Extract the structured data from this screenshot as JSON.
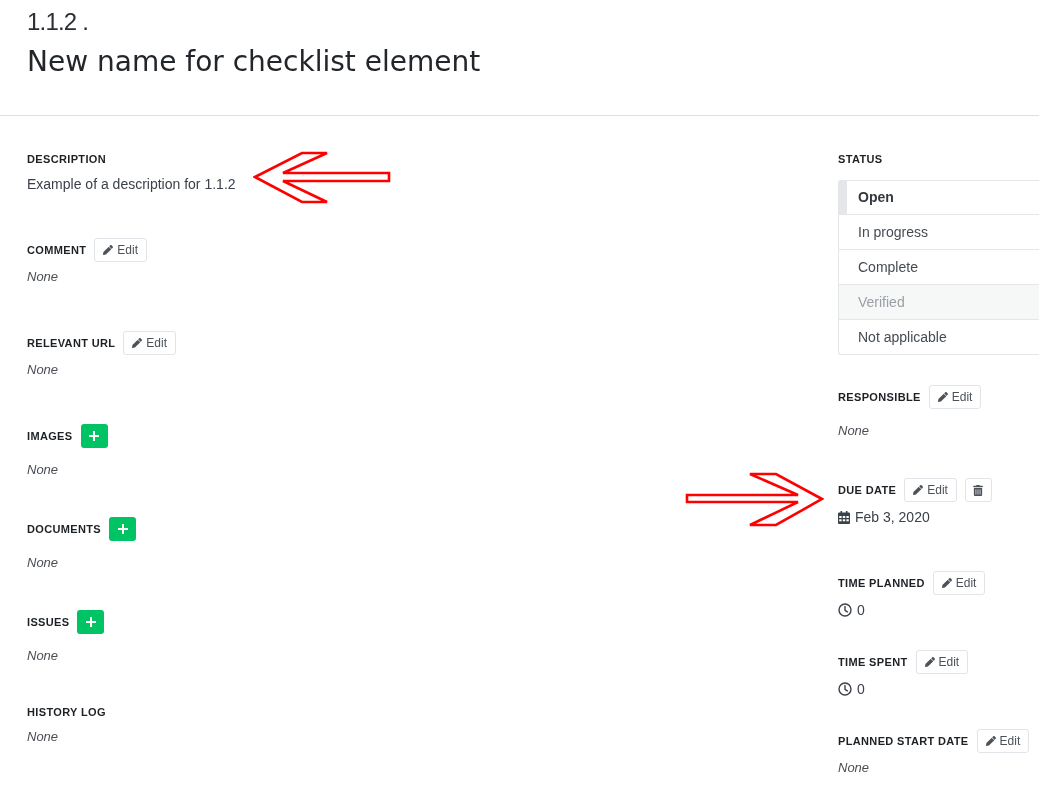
{
  "header": {
    "number": "1.1.2 .",
    "title": "New name for checklist element"
  },
  "main_sections": [
    {
      "label": "DESCRIPTION",
      "kind": "text",
      "value": "Example of a description for 1.1.2",
      "empty": false,
      "arrow": true
    },
    {
      "label": "COMMENT",
      "buttons": [
        {
          "kind": "edit",
          "label": "Edit"
        }
      ],
      "kind": "text",
      "value": "None",
      "empty": true,
      "arrow": false
    },
    {
      "label": "RELEVANT URL",
      "buttons": [
        {
          "kind": "edit",
          "label": "Edit"
        }
      ],
      "kind": "text",
      "value": "None",
      "empty": true,
      "arrow": false
    },
    {
      "label": "IMAGES",
      "buttons": [
        {
          "kind": "add"
        }
      ],
      "kind": "text",
      "value": "None",
      "empty": true,
      "arrow": false
    },
    {
      "label": "DOCUMENTS",
      "buttons": [
        {
          "kind": "add"
        }
      ],
      "kind": "text",
      "value": "None",
      "empty": true,
      "arrow": false
    },
    {
      "label": "ISSUES",
      "buttons": [
        {
          "kind": "add"
        }
      ],
      "kind": "text",
      "value": "None",
      "empty": true,
      "arrow": false
    },
    {
      "label": "HISTORY LOG",
      "kind": "text",
      "value": "None",
      "empty": true,
      "arrow": false
    }
  ],
  "status": {
    "label": "STATUS",
    "options": [
      {
        "label": "Open",
        "selected": true,
        "disabled": false
      },
      {
        "label": "In progress",
        "selected": false,
        "disabled": false
      },
      {
        "label": "Complete",
        "selected": false,
        "disabled": false
      },
      {
        "label": "Verified",
        "selected": false,
        "disabled": true
      },
      {
        "label": "Not applicable",
        "selected": false,
        "disabled": false
      }
    ]
  },
  "side_sections": [
    {
      "label": "RESPONSIBLE",
      "buttons": [
        {
          "kind": "edit",
          "label": "Edit"
        }
      ],
      "kind": "text",
      "value": "None",
      "empty": true,
      "arrow": false
    },
    {
      "label": "DUE DATE",
      "buttons": [
        {
          "kind": "edit",
          "label": "Edit"
        },
        {
          "kind": "delete"
        }
      ],
      "kind": "date",
      "value": "Feb 3, 2020",
      "empty": false,
      "arrow": true
    },
    {
      "label": "TIME PLANNED",
      "buttons": [
        {
          "kind": "edit",
          "label": "Edit"
        }
      ],
      "kind": "duration",
      "value": "0",
      "empty": false,
      "arrow": false
    },
    {
      "label": "TIME SPENT",
      "buttons": [
        {
          "kind": "edit",
          "label": "Edit"
        }
      ],
      "kind": "duration",
      "value": "0",
      "empty": false,
      "arrow": false
    },
    {
      "label": "PLANNED START DATE",
      "buttons": [
        {
          "kind": "edit",
          "label": "Edit"
        }
      ],
      "kind": "text",
      "value": "None",
      "empty": true,
      "arrow": false
    }
  ]
}
